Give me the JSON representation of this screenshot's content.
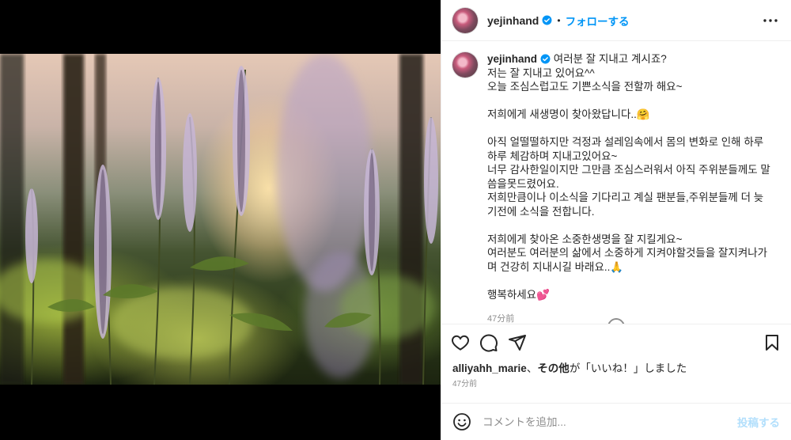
{
  "header": {
    "username": "yejinhand",
    "separator": "•",
    "follow_label": "フォローする",
    "more_icon": "more-horizontal-icon"
  },
  "caption": {
    "username": "yejinhand",
    "text": "여러분 잘 지내고 계시죠?\n저는 잘 지내고 있어요^^\n오늘 조심스럽고도 기쁜소식을 전할까 해요~\n\n저희에게 새생명이 찾아왔답니다..🤗\n\n아직 얼떨떨하지만 걱정과 설레임속에서 몸의 변화로 인해 하루하루 체감하며 지내고있어요~\n너무 감사한일이지만 그만큼 조심스러워서 아직 주위분들께도 말씀을못드렸어요.\n저희만큼이나 이소식을 기다리고 계실 팬분들,주위분들께 더 늦기전에 소식을 전합니다.\n\n저희에게 찾아온 소중한생명을 잘 지킬게요~\n여러분도 여러분의 삶에서 소중하게 지켜야할것들을 잘지켜나가며 건강히 지내시길 바래요..🙏\n\n행복하세요💕",
    "time": "47分前"
  },
  "actions": {
    "like_icon": "heart-icon",
    "comment_icon": "comment-icon",
    "share_icon": "send-icon",
    "save_icon": "bookmark-icon"
  },
  "likes": {
    "user": "alliyahh_marie",
    "sep": "、",
    "others": "その他",
    "suffix": "が「いいね！」しました"
  },
  "post_time": "47分前",
  "comment": {
    "emoji_icon": "smiley-icon",
    "placeholder": "コメントを追加...",
    "post_label": "投稿する"
  },
  "colors": {
    "accent": "#0095f6",
    "post_disabled": "#b2dffc",
    "muted": "#8e8e8e"
  }
}
